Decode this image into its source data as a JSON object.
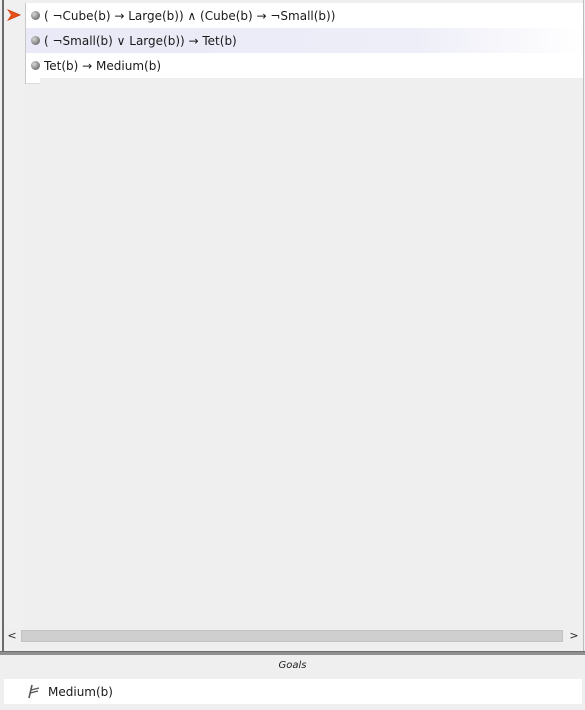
{
  "proof": {
    "steps": [
      {
        "text": "( ¬Cube(b) → Large(b)) ∧ (Cube(b) → ¬Small(b))",
        "highlighted": false
      },
      {
        "text": "( ¬Small(b) ∨ Large(b)) → Tet(b)",
        "highlighted": true
      },
      {
        "text": "Tet(b) → Medium(b)",
        "highlighted": false
      }
    ],
    "pointer_icon": "focus-arrow-icon",
    "bullet_icon": "step-bullet-icon"
  },
  "scrollbar": {
    "left_arrow": "<",
    "right_arrow": ">"
  },
  "goals": {
    "header": "Goals",
    "items": [
      {
        "text": "Medium(b)",
        "icon": "goal-turnstile-icon"
      }
    ]
  },
  "colors": {
    "pointer": "#cc3300",
    "highlight": "#e9e9f7",
    "background": "#efefef"
  }
}
